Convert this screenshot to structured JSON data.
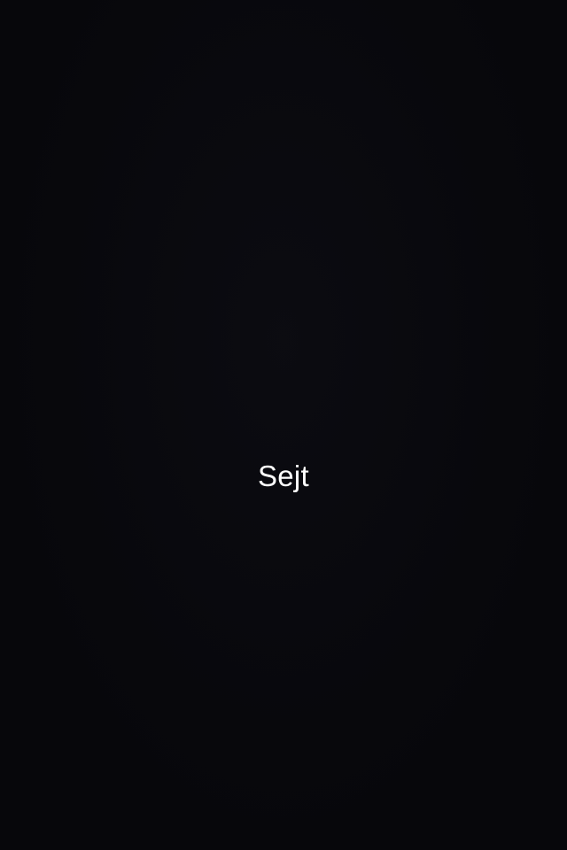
{
  "screen": {
    "background_color": "#07070b",
    "text_color": "#ffffff",
    "center_text": "Sejt"
  }
}
